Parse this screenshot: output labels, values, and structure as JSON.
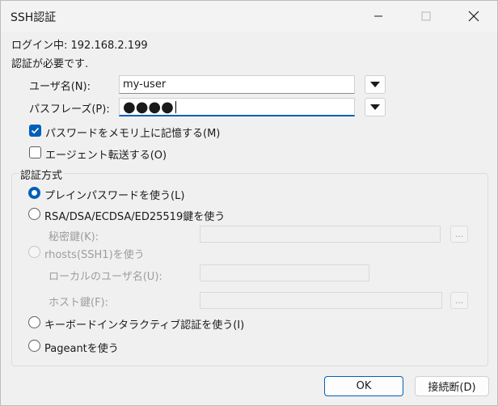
{
  "window": {
    "title": "SSH認証",
    "login_status": "ログイン中: 192.168.2.199",
    "auth_required": "認証が必要です."
  },
  "fields": {
    "username_label": "ユーザ名(N):",
    "username_value": "my-user",
    "passphrase_label": "パスフレーズ(P):",
    "passphrase_value": "●●●●"
  },
  "options": {
    "remember_password": "パスワードをメモリ上に記憶する(M)",
    "remember_password_checked": true,
    "agent_forwarding": "エージェント転送する(O)",
    "agent_forwarding_checked": false
  },
  "auth_method": {
    "group_label": "認証方式",
    "plain_password": "プレインパスワードを使う(L)",
    "public_key": "RSA/DSA/ECDSA/ED25519鍵を使う",
    "private_key_label": "秘密鍵(K):",
    "browse_label": "...",
    "rhosts": "rhosts(SSH1)を使う",
    "local_user_label": "ローカルのユーザ名(U):",
    "host_key_label": "ホスト鍵(F):",
    "keyboard_interactive": "キーボードインタラクティブ認証を使う(I)",
    "pageant": "Pageantを使う",
    "selected": "plain_password"
  },
  "buttons": {
    "ok": "OK",
    "disconnect": "接続断(D)"
  },
  "colors": {
    "accent": "#005fb8",
    "background": "#f0f0f0"
  }
}
